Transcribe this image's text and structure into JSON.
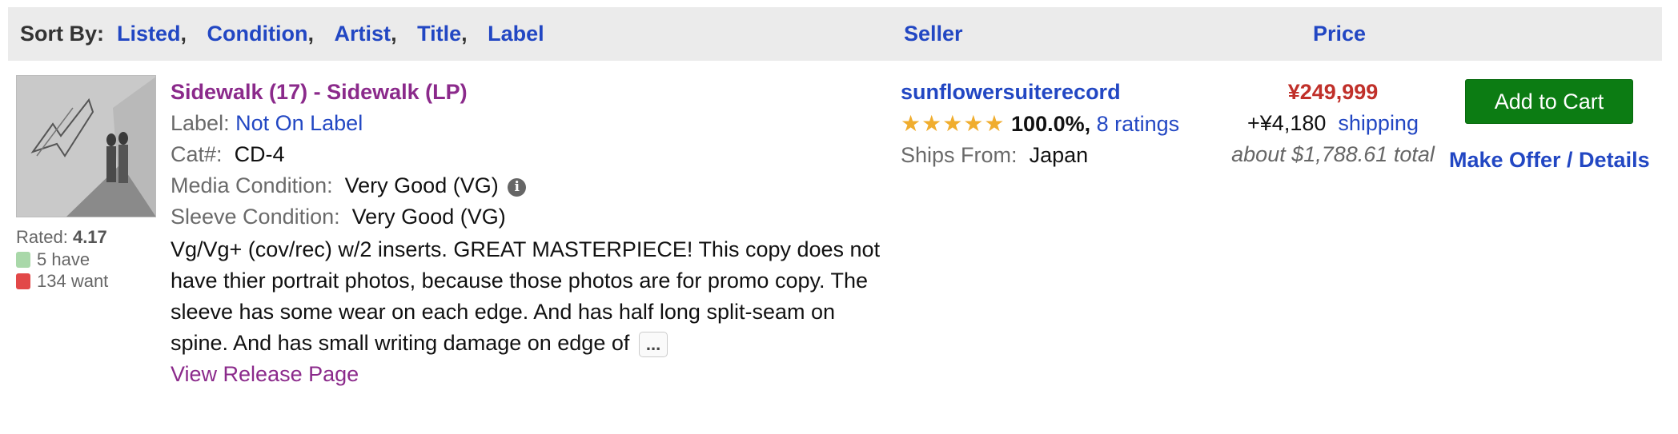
{
  "header": {
    "sort_by_label": "Sort By:",
    "sort_links": [
      "Listed",
      "Condition",
      "Artist",
      "Title",
      "Label"
    ],
    "seller_col": "Seller",
    "price_col": "Price"
  },
  "item": {
    "title": "Sidewalk (17) - Sidewalk (LP)",
    "label_label": "Label:",
    "label_value": "Not On Label",
    "cat_label": "Cat#:",
    "cat_value": "CD-4",
    "media_label": "Media Condition:",
    "media_value": "Very Good (VG)",
    "sleeve_label": "Sleeve Condition:",
    "sleeve_value": "Very Good (VG)",
    "comments": "Vg/Vg+ (cov/rec) w/2 inserts. GREAT MASTERPIECE! This copy does not have thier portrait photos, because those photos are for promo copy. The sleeve has some wear on each edge. And has half long split-seam on spine. And has small writing damage on edge of",
    "more_label": "...",
    "view_release": "View Release Page"
  },
  "stats": {
    "rated_label": "Rated:",
    "rated_value": "4.17",
    "have": "5 have",
    "want": "134 want"
  },
  "seller": {
    "name": "sunflowersuiterecord",
    "stars": "★★★★★",
    "rating_pct": "100.0%,",
    "ratings_link": "8 ratings",
    "ships_from_label": "Ships From:",
    "ships_from_value": "Japan"
  },
  "price": {
    "main": "¥249,999",
    "shipping_amount": "+¥4,180",
    "shipping_link": "shipping",
    "total": "about $1,788.61 total"
  },
  "actions": {
    "add_to_cart": "Add to Cart",
    "make_offer": "Make Offer / Details"
  },
  "colors": {
    "header_bg": "#ebebeb",
    "link": "#2247c3",
    "title": "#8b2a8b",
    "price": "#c0302a",
    "cart_button": "#0c7c13",
    "stars": "#f0ad2e"
  }
}
